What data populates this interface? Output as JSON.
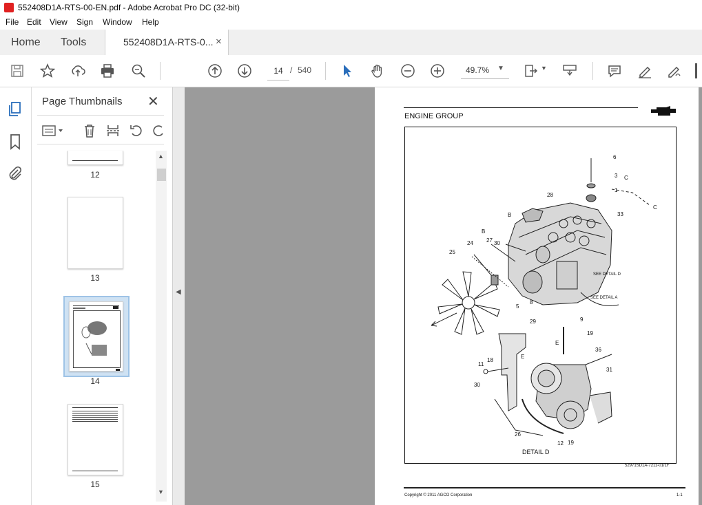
{
  "window": {
    "title": "552408D1A-RTS-00-EN.pdf - Adobe Acrobat Pro DC (32-bit)"
  },
  "menu": [
    "File",
    "Edit",
    "View",
    "Sign",
    "Window",
    "Help"
  ],
  "tabs": {
    "home": "Home",
    "tools": "Tools",
    "document": "552408D1A-RTS-0...",
    "close": "×"
  },
  "toolbar": {
    "current_page": "14",
    "page_separator": "/",
    "total_pages": "540",
    "zoom": "49.7%",
    "icons": [
      "save-icon",
      "star-icon",
      "upload-icon",
      "print-icon",
      "zoom-search-icon",
      "page-up-icon",
      "page-down-icon",
      "select-arrow-icon",
      "hand-icon",
      "zoom-out-icon",
      "zoom-in-icon",
      "page-fit-icon",
      "scroll-mode-icon",
      "comment-icon",
      "highlight-pen-icon",
      "sign-icon"
    ]
  },
  "thumbnails": {
    "title": "Page Thumbnails",
    "close": "✕",
    "items": [
      {
        "page": "12"
      },
      {
        "page": "13"
      },
      {
        "page": "14",
        "selected": true
      },
      {
        "page": "15"
      }
    ]
  },
  "document": {
    "section_title": "ENGINE GROUP",
    "detail_label": "DETAIL D",
    "figure_code": "52971SD1A-7211-01/1F",
    "see_detail_d": "SEE DETAIL D",
    "see_detail_a": "SEE DETAIL A",
    "footer_left": "Copyright © 2011 AGCO Corporation",
    "footer_right": "1-1",
    "callouts": [
      "6",
      "3",
      "C",
      "1",
      "C",
      "28",
      "33",
      "B",
      "B",
      "27",
      "30",
      "24",
      "25",
      "5",
      "8",
      "29",
      "9",
      "19",
      "E",
      "E",
      "36",
      "11",
      "18",
      "31",
      "30",
      "26",
      "12",
      "19"
    ]
  },
  "colors": {
    "accent": "#2a6ebb",
    "viewer_bg": "#9b9b9b",
    "selected_thumb": "#9ec3e6",
    "pdf_red": "#e02020"
  }
}
